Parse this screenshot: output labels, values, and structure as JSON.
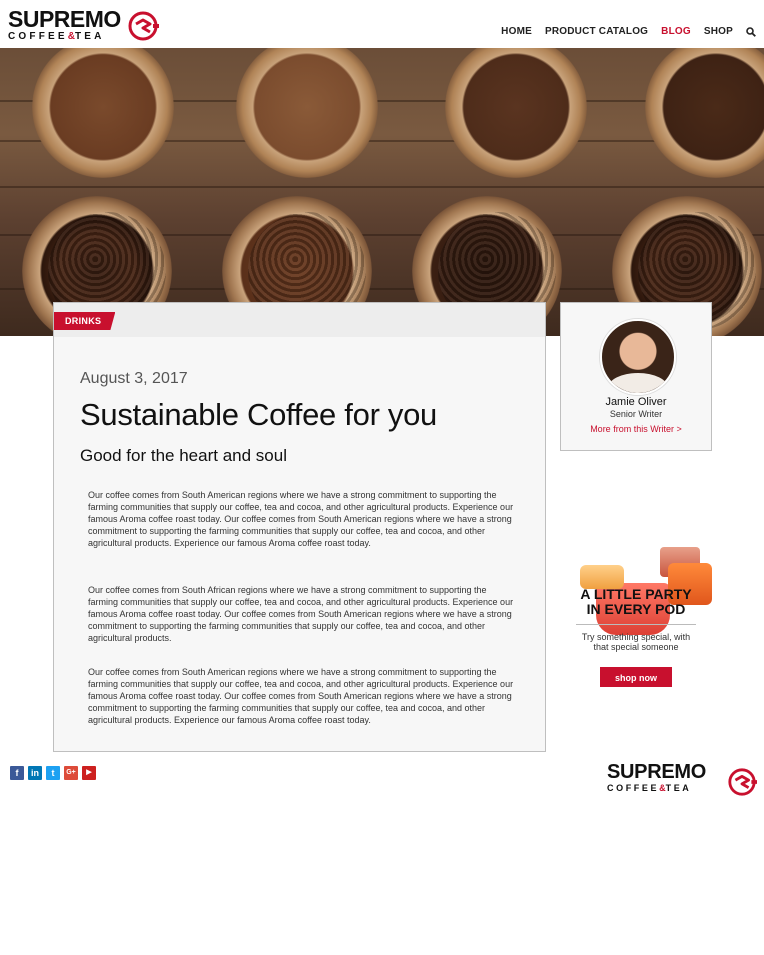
{
  "brand": {
    "name": "SUPREMO",
    "sub_left": "COFFEE",
    "amp": "&",
    "sub_right": "TEA"
  },
  "nav": {
    "items": [
      {
        "label": "HOME",
        "active": false
      },
      {
        "label": "PRODUCT CATALOG",
        "active": false
      },
      {
        "label": "BLOG",
        "active": true
      },
      {
        "label": "SHOP",
        "active": false
      }
    ],
    "search_icon": "search-icon"
  },
  "article": {
    "category": "DRINKS",
    "date": "August 3, 2017",
    "title": "Sustainable Coffee for you",
    "subtitle": "Good for the heart and soul",
    "paragraphs": [
      "Our coffee comes from South American regions where we have a strong commitment to supporting the farming communities that supply our coffee, tea and cocoa, and other agricultural products.  Experience our famous Aroma coffee roast today. Our coffee comes from South American regions where we have a strong commitment to supporting the farming communities that supply our coffee, tea and cocoa, and other agricultural products.  Experience our famous Aroma coffee roast today.",
      "Our coffee comes from South African regions where we have a strong commitment to supporting the farming communities that supply our coffee, tea and cocoa, and other agricultural products.  Experience our famous Aroma coffee roast today. Our coffee comes from South American regions where we have a strong commitment to supporting the farming communities that supply our coffee, tea and cocoa, and other agricultural products.",
      "Our coffee comes from South American regions where we have a strong commitment to supporting the farming communities that supply our coffee, tea and cocoa, and other agricultural products.  Experience our famous Aroma coffee roast today. Our coffee comes from South American regions where we have a strong commitment to supporting the farming communities that supply our coffee, tea and cocoa, and other agricultural products.  Experience our famous Aroma coffee roast today."
    ]
  },
  "author": {
    "name": "Jamie Oliver",
    "role": "Senior Writer",
    "more_link": "More from this Writer >"
  },
  "ad": {
    "headline_1": "A LITTLE PARTY",
    "headline_2": "IN EVERY POD",
    "body_1": "Try something special, with",
    "body_2": "that special someone",
    "button": "shop now"
  },
  "social": [
    {
      "icon": "facebook-icon",
      "glyph": "f",
      "color": "#3b5998"
    },
    {
      "icon": "linkedin-icon",
      "glyph": "in",
      "color": "#0077b5"
    },
    {
      "icon": "twitter-icon",
      "glyph": "t",
      "color": "#1da1f2"
    },
    {
      "icon": "google-plus-icon",
      "glyph": "G+",
      "color": "#dd4b39"
    },
    {
      "icon": "youtube-icon",
      "glyph": "▶",
      "color": "#cd201f"
    }
  ],
  "colors": {
    "accent": "#c8102e",
    "text": "#111111"
  }
}
